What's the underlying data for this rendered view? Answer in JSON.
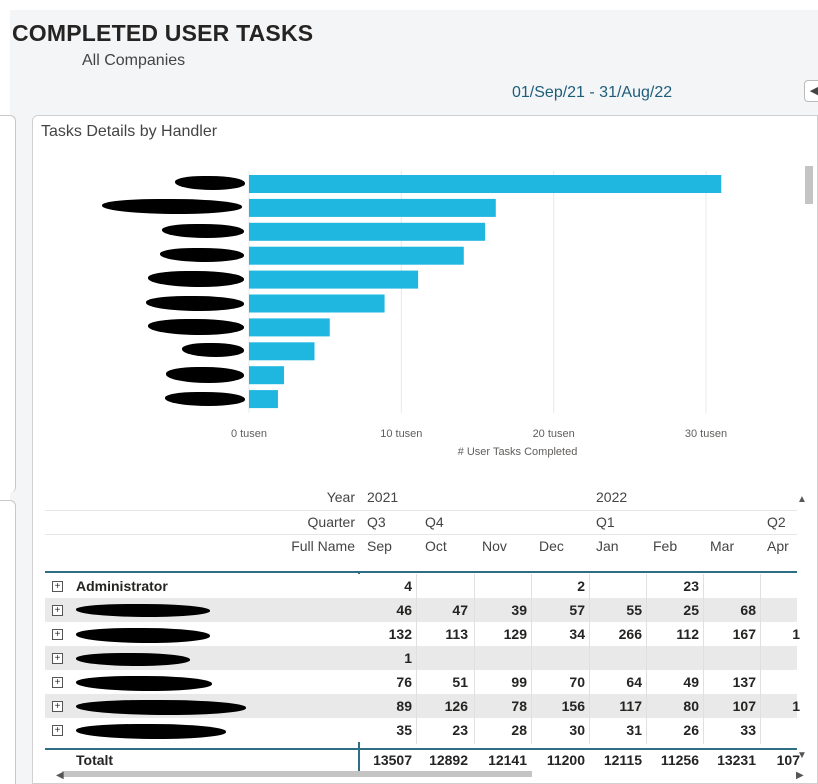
{
  "header": {
    "title": "COMPLETED USER TASKS",
    "subtitle": "All Companies",
    "date_range": "01/Sep/21 - 31/Aug/22",
    "nav_button_icon": "chevron-left-icon"
  },
  "visual": {
    "title": "Tasks Details by Handler"
  },
  "chart_data": {
    "type": "bar",
    "orientation": "horizontal",
    "bar_color": "#1fb6e0",
    "values": [
      31000,
      16200,
      15500,
      14100,
      11100,
      8900,
      5300,
      4300,
      2300,
      1900
    ],
    "categories_redacted": true,
    "xlim": [
      0,
      31000
    ],
    "x_ticks": [
      0,
      10000,
      20000,
      30000
    ],
    "x_tick_labels": [
      "0 tusen",
      "10 tusen",
      "20 tusen",
      "30 tusen"
    ],
    "xlabel": "# User Tasks Completed",
    "grid": true
  },
  "matrix": {
    "row_header_labels": {
      "year": "Year",
      "quarter": "Quarter",
      "full_name": "Full Name"
    },
    "years": [
      "2021",
      "2022"
    ],
    "quarters": [
      "Q3",
      "Q4",
      "Q1",
      "Q2"
    ],
    "months": [
      "Sep",
      "Oct",
      "Nov",
      "Dec",
      "Jan",
      "Feb",
      "Mar",
      "Apr"
    ],
    "rows": [
      {
        "name": "Administrator",
        "values": [
          "4",
          "",
          "",
          "2",
          "",
          "23",
          "",
          ""
        ]
      },
      {
        "name": "",
        "values": [
          "46",
          "47",
          "39",
          "57",
          "55",
          "25",
          "68",
          ""
        ]
      },
      {
        "name": "",
        "values": [
          "132",
          "113",
          "129",
          "34",
          "266",
          "112",
          "167",
          "1"
        ]
      },
      {
        "name": "",
        "values": [
          "1",
          "",
          "",
          "",
          "",
          "",
          "",
          ""
        ]
      },
      {
        "name": "",
        "values": [
          "76",
          "51",
          "99",
          "70",
          "64",
          "49",
          "137",
          ""
        ]
      },
      {
        "name": "",
        "values": [
          "89",
          "126",
          "78",
          "156",
          "117",
          "80",
          "107",
          "1"
        ]
      },
      {
        "name": "",
        "values": [
          "35",
          "23",
          "28",
          "30",
          "31",
          "26",
          "33",
          ""
        ]
      }
    ],
    "total": {
      "label": "Totalt",
      "values": [
        "13507",
        "12892",
        "12141",
        "11200",
        "12115",
        "11256",
        "13231",
        "107"
      ]
    }
  }
}
